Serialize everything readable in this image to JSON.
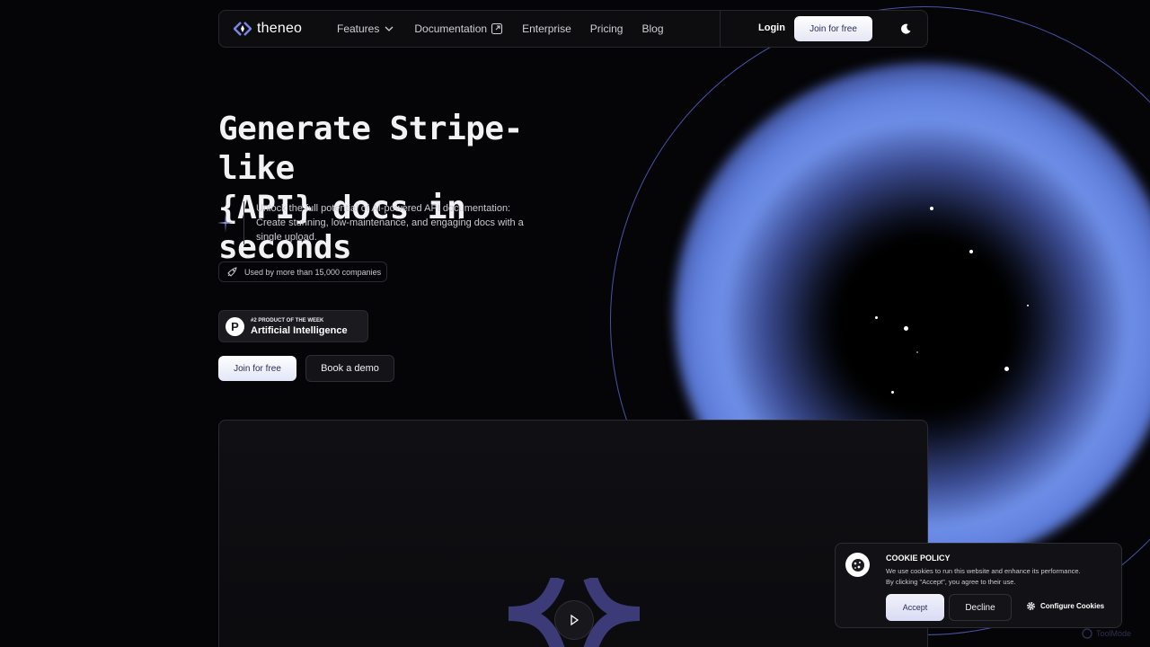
{
  "nav": {
    "logo_text": "theneo",
    "links": [
      {
        "label": "Features",
        "icon": "chevron-down-icon"
      },
      {
        "label": "Documentation",
        "icon": "external-link-icon"
      },
      {
        "label": "Enterprise"
      },
      {
        "label": "Pricing"
      },
      {
        "label": "Blog"
      }
    ],
    "login_label": "Login",
    "join_label": "Join for free",
    "theme_icon": "moon-icon"
  },
  "hero": {
    "title_line1": "Generate Stripe-like",
    "title_line2": "{API} docs in seconds",
    "lead": "Unlock the full potential of AI-powered API documentation: Create stunning, low-maintenance, and engaging docs with a single upload.",
    "companies_pill": "Used by more than 15,000 companies",
    "product_hunt": {
      "logo_letter": "P",
      "rank": "#2 PRODUCT OF THE WEEK",
      "category": "Artificial Intelligence"
    },
    "join_label": "Join for free",
    "demo_label": "Book a demo"
  },
  "cookie": {
    "title": "COOKIE POLICY",
    "line1": "We use cookies to run this website and enhance its performance.",
    "line2": "By clicking \"Accept\", you agree to their use.",
    "accept": "Accept",
    "decline": "Decline",
    "configure": "Configure Cookies"
  },
  "watermark": "ToolMode",
  "colors": {
    "background": "#050507",
    "accent": "#6e8fe8",
    "ring": "#5560c8"
  }
}
